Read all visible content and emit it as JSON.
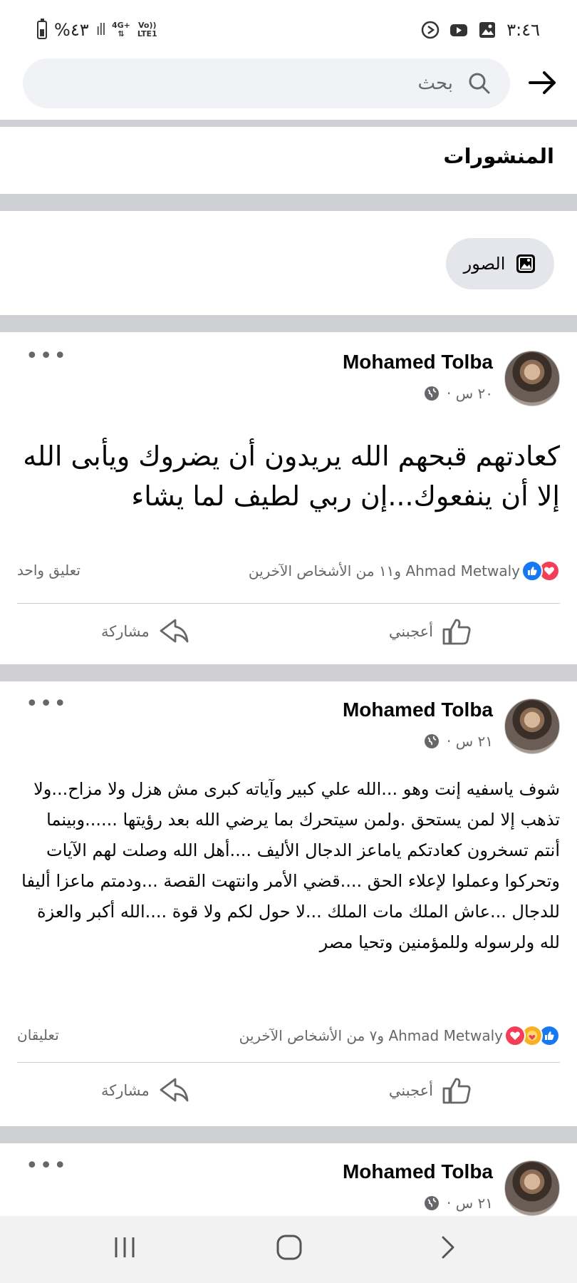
{
  "status_bar": {
    "battery": "%٤٣",
    "network": "4G+",
    "volte": "Vo))",
    "lte": "LTE1",
    "time": "٣:٤٦"
  },
  "search": {
    "placeholder": "بحث"
  },
  "section": {
    "title": "المنشورات",
    "filter_chip": "الصور"
  },
  "posts": [
    {
      "author": "Mohamed Tolba",
      "time": "٢٠ س ·",
      "text": "كعادتهم قبحهم الله يريدون أن يضروك ويأبى الله إلا أن ينفعوك...إن ربي لطيف لما يشاء",
      "reactions_text": "Ahmad Metwaly و١١ من الأشخاص الآخرين",
      "comments": "تعليق واحد",
      "like_label": "أعجبني",
      "share_label": "مشاركة"
    },
    {
      "author": "Mohamed Tolba",
      "time": "٢١ س ·",
      "text": "شوف ياسفيه إنت وهو ...الله علي كبير وآياته كبرى مش هزل ولا مزاح...ولا تذهب إلا لمن يستحق .ولمن سيتحرك بما يرضي الله بعد رؤيتها ......وبينما أنتم تسخرون كعادتكم ياماعز الدجال الأليف ....أهل الله وصلت لهم الآيات وتحركوا وعملوا لإعلاء الحق ....قضي الأمر وانتهت القصة ...ودمتم ماعزا أليفا للدجال ...عاش الملك مات الملك ...لا حول لكم ولا قوة ....الله أكبر والعزة لله ولرسوله وللمؤمنين وتحيا مصر",
      "reactions_text": "Ahmad Metwaly و٧ من الأشخاص الآخرين",
      "comments": "تعليقان",
      "like_label": "أعجبني",
      "share_label": "مشاركة"
    },
    {
      "author": "Mohamed Tolba",
      "time": "٢١ س ·"
    }
  ],
  "more_glyph": "•••",
  "colors": {
    "facebook_blue": "#1877f2",
    "love_red": "#f33e58",
    "separator_gray": "#ced0d4",
    "secondary_text": "#65676b"
  }
}
